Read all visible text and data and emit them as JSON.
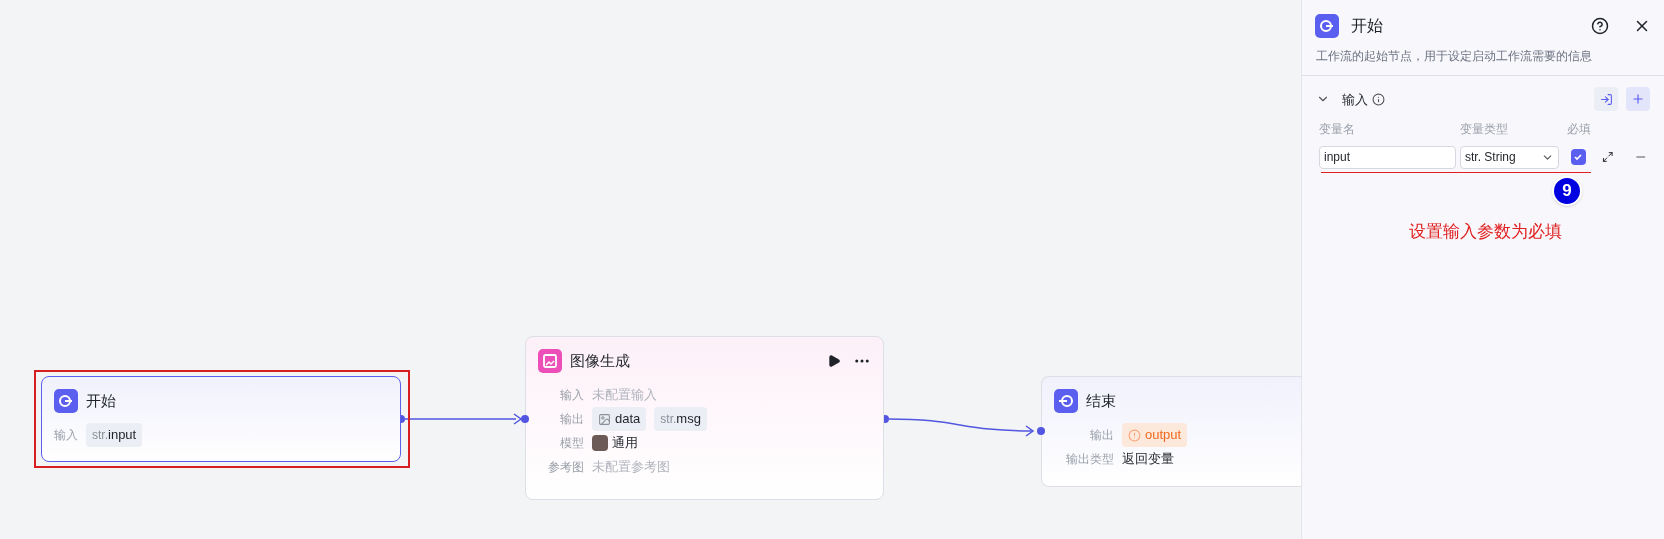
{
  "canvas": {
    "nodes": [
      {
        "kind": "start",
        "title": "开始",
        "selected": true,
        "highlighted": true,
        "rows": [
          {
            "label": "输入",
            "values": [
              {
                "kind": "tag",
                "prefix": "str.",
                "text": "input"
              }
            ]
          }
        ]
      },
      {
        "kind": "image",
        "title": "图像生成",
        "selected": false,
        "actions": true,
        "rows": [
          {
            "label": "输入",
            "values": [
              {
                "kind": "empty",
                "text": "未配置输入"
              }
            ]
          },
          {
            "label": "输出",
            "values": [
              {
                "kind": "image-tag",
                "text": "data"
              },
              {
                "kind": "tag",
                "prefix": "str.",
                "text": "msg"
              }
            ]
          },
          {
            "label": "模型",
            "values": [
              {
                "kind": "model",
                "text": "通用"
              }
            ]
          },
          {
            "label": "参考图",
            "values": [
              {
                "kind": "empty",
                "text": "未配置参考图"
              }
            ]
          }
        ]
      },
      {
        "kind": "end",
        "title": "结束",
        "selected": false,
        "rows": [
          {
            "label": "输出",
            "values": [
              {
                "kind": "warn-tag",
                "text": "output"
              }
            ]
          },
          {
            "label": "输出类型",
            "values": [
              {
                "kind": "text",
                "text": "返回变量"
              }
            ]
          }
        ]
      }
    ]
  },
  "panel": {
    "title": "开始",
    "description": "工作流的起始节点，用于设定启动工作流需要的信息",
    "section": {
      "title": "输入",
      "expanded": true
    },
    "columns": [
      "变量名",
      "变量类型",
      "必填"
    ],
    "rows": [
      {
        "name": "input",
        "type": "str. String",
        "required": true
      }
    ]
  },
  "annotation": {
    "badge": "9",
    "note": "设置输入参数为必填"
  }
}
